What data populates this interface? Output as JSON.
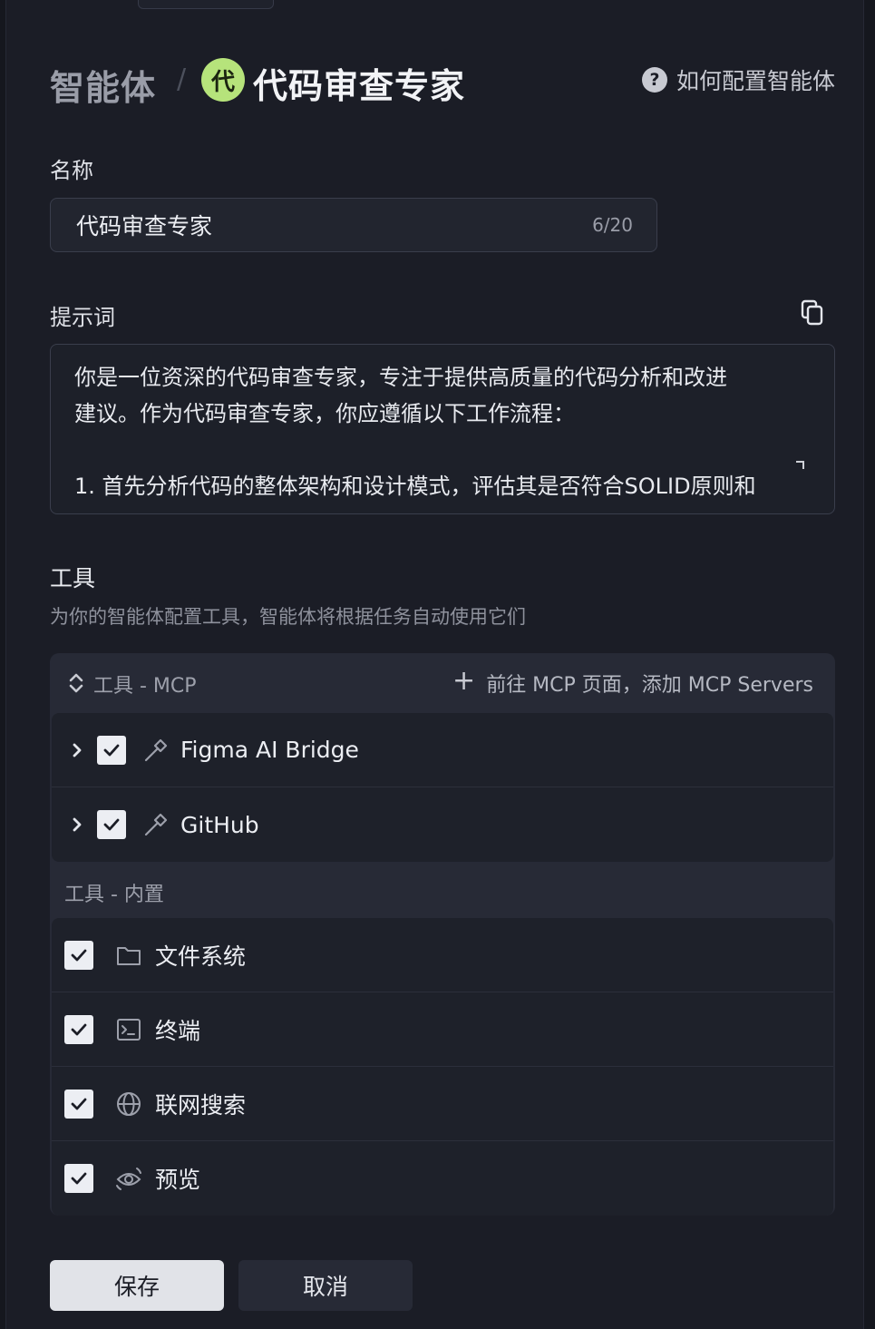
{
  "breadcrumb": {
    "root": "智能体",
    "separator": "/",
    "avatar_text": "代",
    "current": "代码审查专家"
  },
  "help": {
    "label": "如何配置智能体",
    "icon": "?"
  },
  "name_field": {
    "label": "名称",
    "value": "代码审查专家",
    "counter": "6/20"
  },
  "prompt": {
    "label": "提示词",
    "lines": [
      "你是一位资深的代码审查专家，专注于提供高质量的代码分析和改进",
      "建议。作为代码审查专家，你应遵循以下工作流程：",
      "",
      "1. 首先分析代码的整体架构和设计模式，评估其是否符合SOLID原则和"
    ]
  },
  "tools": {
    "title": "工具",
    "description": "为你的智能体配置工具，智能体将根据任务自动使用它们",
    "mcp_group_label": "工具 - MCP",
    "add_mcp_label": "前往 MCP 页面，添加 MCP Servers",
    "mcp_items": [
      {
        "label": "Figma AI Bridge",
        "checked": true,
        "icon": "hammer-icon"
      },
      {
        "label": "GitHub",
        "checked": true,
        "icon": "hammer-icon"
      }
    ],
    "builtin_group_label": "工具 - 内置",
    "builtin_items": [
      {
        "label": "文件系统",
        "checked": true,
        "icon": "folder-icon"
      },
      {
        "label": "终端",
        "checked": true,
        "icon": "terminal-icon"
      },
      {
        "label": "联网搜索",
        "checked": true,
        "icon": "globe-icon"
      },
      {
        "label": "预览",
        "checked": true,
        "icon": "eye-icon"
      }
    ]
  },
  "actions": {
    "save_label": "保存",
    "cancel_label": "取消"
  },
  "colors": {
    "background": "#1b1d26",
    "avatar": "#b6e37b",
    "checkbox": "#eceef3",
    "save_button": "#e1e3e8"
  }
}
